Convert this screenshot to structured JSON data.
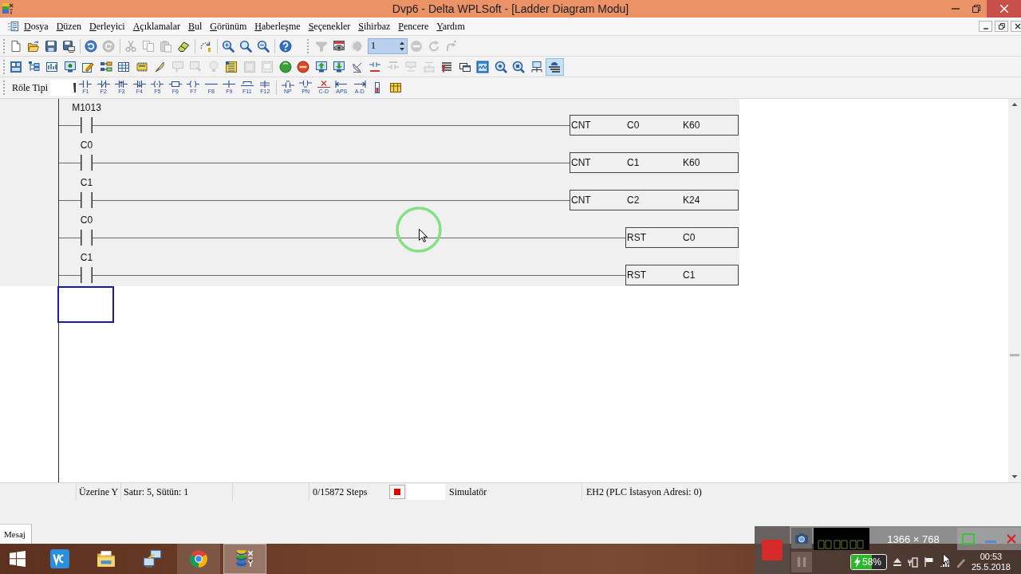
{
  "window": {
    "title": "Dvp6 - Delta WPLSoft - [Ladder Diagram Modu]"
  },
  "menu": [
    "Dosya",
    "Düzen",
    "Derleyici",
    "Açıklamalar",
    "Bul",
    "Görünüm",
    "Haberleşme",
    "Seçenekler",
    "Sihirbaz",
    "Pencere",
    "Yardım"
  ],
  "toolbar_1": {
    "buttons": [
      {
        "disabled": false
      },
      {
        "disabled": false
      },
      {
        "disabled": false
      },
      {
        "disabled": false
      },
      {
        "disabled": false
      },
      {
        "disabled": true
      },
      {
        "disabled": true
      },
      {
        "disabled": true
      },
      {
        "disabled": true
      },
      {
        "disabled": false
      },
      {
        "disabled": false
      },
      {
        "disabled": false
      },
      {
        "disabled": false
      },
      {
        "disabled": false
      },
      {
        "disabled": false
      },
      {
        "disabled": true
      },
      {
        "disabled": false
      },
      {
        "disabled": true
      },
      {
        "disabled": true
      },
      {
        "disabled": true
      },
      {
        "disabled": true
      }
    ],
    "page_field": {
      "value": "1"
    }
  },
  "toolbar_2": {
    "buttons": [
      {
        "disabled": false,
        "pressed": false
      },
      {
        "disabled": false,
        "pressed": false
      },
      {
        "disabled": false,
        "pressed": false
      },
      {
        "disabled": false,
        "pressed": false
      },
      {
        "disabled": false,
        "pressed": false
      },
      {
        "disabled": false,
        "pressed": false
      },
      {
        "disabled": false,
        "pressed": false
      },
      {
        "disabled": false,
        "pressed": false
      },
      {
        "disabled": false,
        "pressed": false
      },
      {
        "disabled": true,
        "pressed": false
      },
      {
        "disabled": true,
        "pressed": false
      },
      {
        "disabled": true,
        "pressed": false
      },
      {
        "disabled": false,
        "pressed": false
      },
      {
        "disabled": true,
        "pressed": false
      },
      {
        "disabled": true,
        "pressed": false
      },
      {
        "disabled": false,
        "pressed": false
      },
      {
        "disabled": false,
        "pressed": false
      },
      {
        "disabled": false,
        "pressed": false
      },
      {
        "disabled": false,
        "pressed": false
      },
      {
        "disabled": false,
        "pressed": false
      },
      {
        "disabled": false,
        "pressed": false
      },
      {
        "disabled": true,
        "pressed": false
      },
      {
        "disabled": true,
        "pressed": false
      },
      {
        "disabled": true,
        "pressed": false
      },
      {
        "disabled": false,
        "pressed": false
      },
      {
        "disabled": false,
        "pressed": false
      },
      {
        "disabled": false,
        "pressed": false
      },
      {
        "disabled": false,
        "pressed": false
      },
      {
        "disabled": false,
        "pressed": false
      },
      {
        "disabled": false,
        "pressed": false
      },
      {
        "disabled": false,
        "pressed": true
      }
    ]
  },
  "toolbar_3": {
    "label": "Röle Tipi",
    "buttons": [
      {
        "label": "F1"
      },
      {
        "label": "F2"
      },
      {
        "label": "F3"
      },
      {
        "label": "F4"
      },
      {
        "label": "F5"
      },
      {
        "label": "F6"
      },
      {
        "label": "F7"
      },
      {
        "label": "F8"
      },
      {
        "label": "F9"
      },
      {
        "label": "F11"
      },
      {
        "label": "F12"
      },
      {
        "label": "NP"
      },
      {
        "label": "PN"
      },
      {
        "label": "C-D"
      },
      {
        "label": "APS"
      },
      {
        "label": "A-D"
      }
    ]
  },
  "ladder": {
    "rungs": [
      {
        "contact": "M1013",
        "instruction": {
          "mnemonic": "CNT",
          "operands": [
            "C0",
            "K60"
          ]
        }
      },
      {
        "contact": "C0",
        "instruction": {
          "mnemonic": "CNT",
          "operands": [
            "C1",
            "K60"
          ]
        }
      },
      {
        "contact": "C1",
        "instruction": {
          "mnemonic": "CNT",
          "operands": [
            "C2",
            "K24"
          ]
        }
      },
      {
        "contact": "C0",
        "instruction": {
          "mnemonic": "RST",
          "operands": [
            "C0"
          ]
        }
      },
      {
        "contact": "C1",
        "instruction": {
          "mnemonic": "RST",
          "operands": [
            "C1"
          ]
        }
      }
    ]
  },
  "status_bar": {
    "mode": "Üzerine Y",
    "position": "Satır: 5, Sütün: 1",
    "steps": "0/15872 Steps",
    "connection": "Simulatör",
    "plc": "EH2 (PLC İstasyon Adresi: 0)"
  },
  "message_tabs": [
    {
      "label": "Mesaj",
      "selected": true
    }
  ],
  "taskbar": {
    "apps": [
      {
        "running": false,
        "active": false
      },
      {
        "running": false,
        "active": false
      },
      {
        "running": false,
        "active": false
      },
      {
        "running": true,
        "active": false
      },
      {
        "running": true,
        "active": true
      }
    ]
  },
  "recorder": {
    "resolution": "1366 × 768"
  },
  "tray": {
    "battery": {
      "reading": "58%",
      "level": 0.58
    },
    "time": "00:53",
    "date": "25.5.2018"
  }
}
